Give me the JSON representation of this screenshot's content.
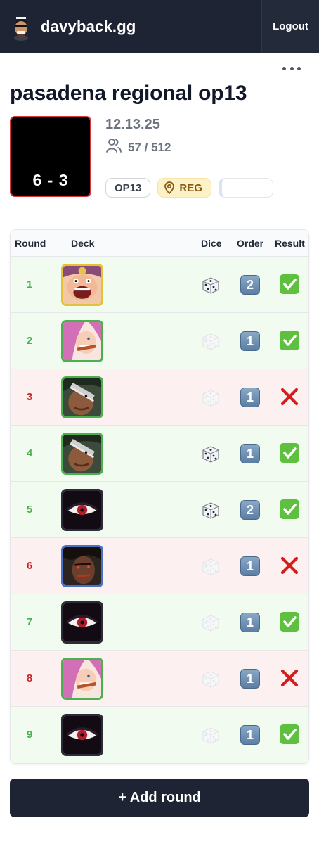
{
  "app": {
    "name": "davyback.gg",
    "logout_label": "Logout"
  },
  "event": {
    "title": "pasadena regional op13",
    "record": "6 - 3",
    "date": "12.13.25",
    "players": "57 / 512",
    "set_badge": "OP13",
    "type_badge": "REG"
  },
  "table": {
    "headers": {
      "round": "Round",
      "deck": "Deck",
      "dice": "Dice",
      "order": "Order",
      "result": "Result"
    },
    "rows": [
      {
        "round": "1",
        "deck": "big-mom-leader",
        "dice_won": true,
        "order": "2",
        "result": "win"
      },
      {
        "round": "2",
        "deck": "jewelry-bonney-leader",
        "dice_won": false,
        "order": "1",
        "result": "win"
      },
      {
        "round": "3",
        "deck": "crocodile-leader",
        "dice_won": false,
        "order": "1",
        "result": "loss"
      },
      {
        "round": "4",
        "deck": "crocodile-leader",
        "dice_won": true,
        "order": "1",
        "result": "win"
      },
      {
        "round": "5",
        "deck": "imu-leader",
        "dice_won": true,
        "order": "2",
        "result": "win"
      },
      {
        "round": "6",
        "deck": "lucci-leader",
        "dice_won": false,
        "order": "1",
        "result": "loss"
      },
      {
        "round": "7",
        "deck": "imu-leader",
        "dice_won": false,
        "order": "1",
        "result": "win"
      },
      {
        "round": "8",
        "deck": "jewelry-bonney-leader",
        "dice_won": false,
        "order": "1",
        "result": "loss"
      },
      {
        "round": "9",
        "deck": "imu-leader",
        "dice_won": false,
        "order": "1",
        "result": "win"
      }
    ]
  },
  "actions": {
    "add_round_label": "+ Add round"
  },
  "colors": {
    "header_bg": "#1e2433",
    "win_row": "#f1fbef",
    "loss_row": "#fcf1f0",
    "win_text": "#4caf50",
    "loss_text": "#c62828",
    "record_border": "#d9363e"
  }
}
